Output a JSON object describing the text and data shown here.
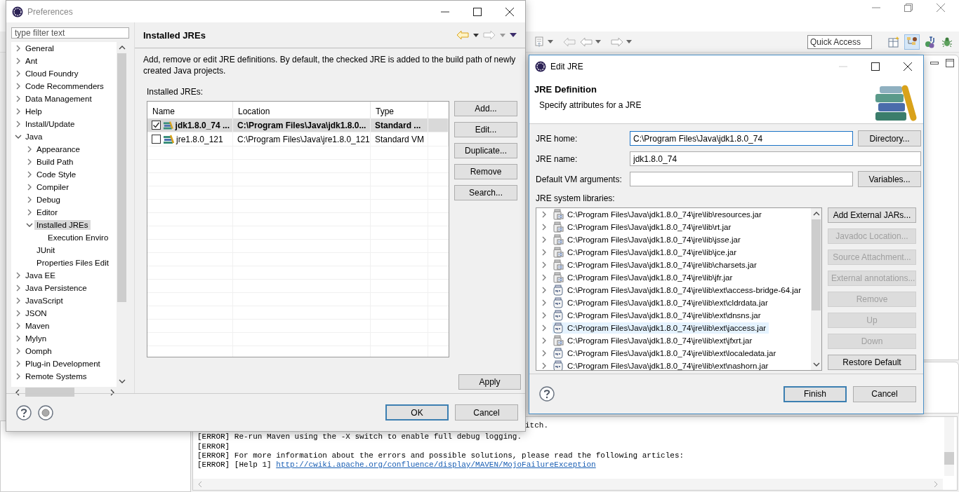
{
  "main_window": {
    "quick_access": {
      "placeholder": "Quick Access"
    }
  },
  "console": {
    "lines": [
      {
        "kind": "covered",
        "text": "itch."
      },
      {
        "kind": "plain",
        "text": "[ERROR] Re-run Maven using the -X switch to enable full debug logging."
      },
      {
        "kind": "plain",
        "text": "[ERROR]"
      },
      {
        "kind": "plain",
        "text": "[ERROR] For more information about the errors and possible solutions, please read the following articles:"
      },
      {
        "kind": "plain",
        "text": "[ERROR] [Help 1] ",
        "link": "http://cwiki.apache.org/confluence/display/MAVEN/MojoFailureException"
      }
    ]
  },
  "preferences": {
    "title": "Preferences",
    "filter": {
      "placeholder": "type filter text"
    },
    "tree": [
      {
        "label": "General",
        "expanded": false,
        "selected": false
      },
      {
        "label": "Ant",
        "expanded": false,
        "selected": false
      },
      {
        "label": "Cloud Foundry",
        "expanded": false,
        "selected": false
      },
      {
        "label": "Code Recommenders",
        "expanded": false,
        "selected": false
      },
      {
        "label": "Data Management",
        "expanded": false,
        "selected": false
      },
      {
        "label": "Help",
        "expanded": false,
        "selected": false
      },
      {
        "label": "Install/Update",
        "expanded": false,
        "selected": false
      },
      {
        "label": "Java",
        "expanded": true,
        "selected": false,
        "children": [
          {
            "label": "Appearance",
            "expanded": false,
            "selected": false
          },
          {
            "label": "Build Path",
            "expanded": false,
            "selected": false
          },
          {
            "label": "Code Style",
            "expanded": false,
            "selected": false
          },
          {
            "label": "Compiler",
            "expanded": false,
            "selected": false
          },
          {
            "label": "Debug",
            "expanded": false,
            "selected": false
          },
          {
            "label": "Editor",
            "expanded": false,
            "selected": false
          },
          {
            "label": "Installed JREs",
            "expanded": true,
            "selected": true,
            "children": [
              {
                "label": "Execution Enviro",
                "selected": false
              }
            ]
          },
          {
            "label": "JUnit",
            "selected": false
          },
          {
            "label": "Properties Files Edit",
            "selected": false
          }
        ]
      },
      {
        "label": "Java EE",
        "expanded": false,
        "selected": false
      },
      {
        "label": "Java Persistence",
        "expanded": false,
        "selected": false
      },
      {
        "label": "JavaScript",
        "expanded": false,
        "selected": false
      },
      {
        "label": "JSON",
        "expanded": false,
        "selected": false
      },
      {
        "label": "Maven",
        "expanded": false,
        "selected": false
      },
      {
        "label": "Mylyn",
        "expanded": false,
        "selected": false
      },
      {
        "label": "Oomph",
        "expanded": false,
        "selected": false
      },
      {
        "label": "Plug-in Development",
        "expanded": false,
        "selected": false
      },
      {
        "label": "Remote Systems",
        "expanded": false,
        "selected": false
      }
    ],
    "page": {
      "title": "Installed JREs",
      "description": "Add, remove or edit JRE definitions. By default, the checked JRE is added to the build path of newly created Java projects.",
      "table_label": "Installed JREs:",
      "table": {
        "columns": [
          "Name",
          "Location",
          "Type"
        ],
        "rows": [
          {
            "cells": [
              "jdk1.8.0_74 ...",
              "C:\\Program Files\\Java\\jdk1.8.0...",
              "Standard ..."
            ],
            "checked": true,
            "selected": true
          },
          {
            "cells": [
              "jre1.8.0_121",
              "C:\\Program Files\\Java\\jre1.8.0_121",
              "Standard VM"
            ],
            "checked": false,
            "selected": false
          }
        ]
      },
      "buttons": [
        "Add...",
        "Edit...",
        "Duplicate...",
        "Remove",
        "Search..."
      ],
      "apply": "Apply"
    },
    "footer_buttons": [
      {
        "label": "OK",
        "default": true
      },
      {
        "label": "Cancel",
        "default": false
      }
    ]
  },
  "edit_jre": {
    "title": "Edit JRE",
    "heading": "JRE Definition",
    "subheading": "Specify attributes for a JRE",
    "fields": [
      {
        "label": "JRE home:",
        "value": "C:\\Program Files\\Java\\jdk1.8.0_74",
        "focused": true,
        "button": "Directory..."
      },
      {
        "label": "JRE name:",
        "value": "jdk1.8.0_74",
        "focused": false
      },
      {
        "label": "Default VM arguments:",
        "focused": false,
        "button": "Variables..."
      }
    ],
    "libraries_label": "JRE system libraries:",
    "libraries": [
      {
        "path": "C:\\Program Files\\Java\\jdk1.8.0_74\\jre\\lib\\resources.jar",
        "kind": "archive",
        "selected": false
      },
      {
        "path": "C:\\Program Files\\Java\\jdk1.8.0_74\\jre\\lib\\rt.jar",
        "kind": "archive",
        "selected": false
      },
      {
        "path": "C:\\Program Files\\Java\\jdk1.8.0_74\\jre\\lib\\jsse.jar",
        "kind": "archive",
        "selected": false
      },
      {
        "path": "C:\\Program Files\\Java\\jdk1.8.0_74\\jre\\lib\\jce.jar",
        "kind": "archive",
        "selected": false
      },
      {
        "path": "C:\\Program Files\\Java\\jdk1.8.0_74\\jre\\lib\\charsets.jar",
        "kind": "archive",
        "selected": false
      },
      {
        "path": "C:\\Program Files\\Java\\jdk1.8.0_74\\jre\\lib\\jfr.jar",
        "kind": "archive",
        "selected": false
      },
      {
        "path": "C:\\Program Files\\Java\\jdk1.8.0_74\\jre\\lib\\ext\\access-bridge-64.jar",
        "kind": "binary",
        "selected": false
      },
      {
        "path": "C:\\Program Files\\Java\\jdk1.8.0_74\\jre\\lib\\ext\\cldrdata.jar",
        "kind": "binary",
        "selected": false
      },
      {
        "path": "C:\\Program Files\\Java\\jdk1.8.0_74\\jre\\lib\\ext\\dnsns.jar",
        "kind": "binary",
        "selected": false
      },
      {
        "path": "C:\\Program Files\\Java\\jdk1.8.0_74\\jre\\lib\\ext\\jaccess.jar",
        "kind": "binary",
        "selected": true
      },
      {
        "path": "C:\\Program Files\\Java\\jdk1.8.0_74\\jre\\lib\\ext\\jfxrt.jar",
        "kind": "archive",
        "selected": false
      },
      {
        "path": "C:\\Program Files\\Java\\jdk1.8.0_74\\jre\\lib\\ext\\localedata.jar",
        "kind": "binary",
        "selected": false
      },
      {
        "path": "C:\\Program Files\\Java\\jdk1.8.0_74\\jre\\lib\\ext\\nashorn.jar",
        "kind": "binary",
        "selected": false
      }
    ],
    "side_buttons": [
      {
        "label": "Add External JARs...",
        "disabled": false
      },
      {
        "label": "Javadoc Location...",
        "disabled": true
      },
      {
        "label": "Source Attachment...",
        "disabled": true
      },
      {
        "label": "External annotations...",
        "disabled": true
      },
      {
        "label": "Remove",
        "disabled": true
      },
      {
        "label": "Up",
        "disabled": true
      },
      {
        "label": "Down",
        "disabled": true
      },
      {
        "label": "Restore Default",
        "disabled": false
      }
    ],
    "footer_buttons": [
      {
        "label": "Finish",
        "default": true
      },
      {
        "label": "Cancel",
        "default": false
      }
    ]
  }
}
